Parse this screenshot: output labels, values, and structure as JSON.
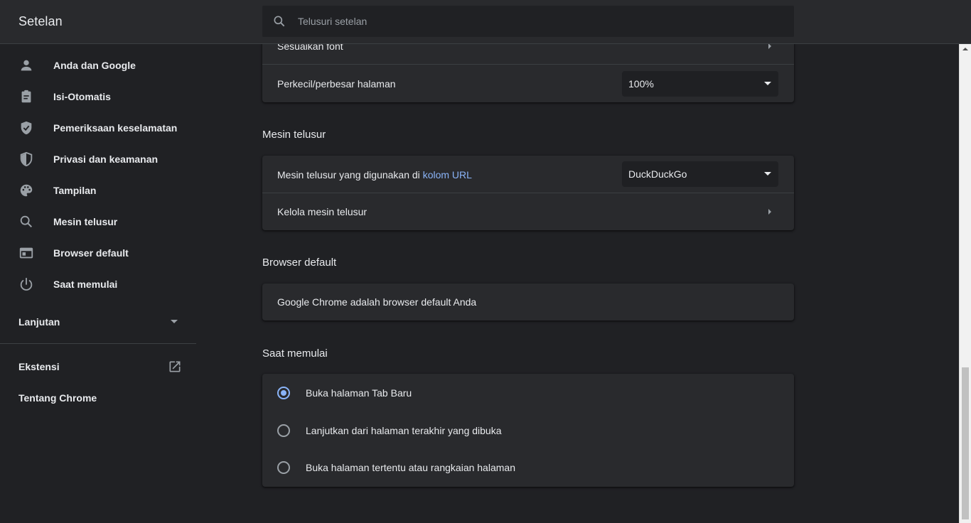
{
  "header": {
    "title": "Setelan",
    "search_placeholder": "Telusuri setelan"
  },
  "sidebar": {
    "items": [
      {
        "label": "Anda dan Google",
        "icon": "person-icon"
      },
      {
        "label": "Isi-Otomatis",
        "icon": "clipboard-icon"
      },
      {
        "label": "Pemeriksaan keselamatan",
        "icon": "shield-check-icon"
      },
      {
        "label": "Privasi dan keamanan",
        "icon": "shield-half-icon"
      },
      {
        "label": "Tampilan",
        "icon": "palette-icon"
      },
      {
        "label": "Mesin telusur",
        "icon": "search-icon"
      },
      {
        "label": "Browser default",
        "icon": "browser-window-icon"
      },
      {
        "label": "Saat memulai",
        "icon": "power-icon"
      }
    ],
    "advanced_label": "Lanjutan",
    "extensions_label": "Ekstensi",
    "about_label": "Tentang Chrome"
  },
  "appearance": {
    "font_row_label": "Sesuaikan font",
    "zoom_label": "Perkecil/perbesar halaman",
    "zoom_value": "100%"
  },
  "search_engine": {
    "section_title": "Mesin telusur",
    "engine_label_prefix": "Mesin telusur yang digunakan di ",
    "engine_label_link": "kolom URL",
    "engine_value": "DuckDuckGo",
    "manage_label": "Kelola mesin telusur"
  },
  "default_browser": {
    "section_title": "Browser default",
    "status_text": "Google Chrome adalah browser default Anda"
  },
  "on_startup": {
    "section_title": "Saat memulai",
    "options": [
      {
        "label": "Buka halaman Tab Baru",
        "selected": true
      },
      {
        "label": "Lanjutkan dari halaman terakhir yang dibuka",
        "selected": false
      },
      {
        "label": "Buka halaman tertentu atau rangkaian halaman",
        "selected": false
      }
    ]
  },
  "colors": {
    "background": "#202124",
    "card": "#292a2d",
    "accent": "#8ab4f8",
    "text": "#e8eaed",
    "icon": "#9aa0a6"
  }
}
